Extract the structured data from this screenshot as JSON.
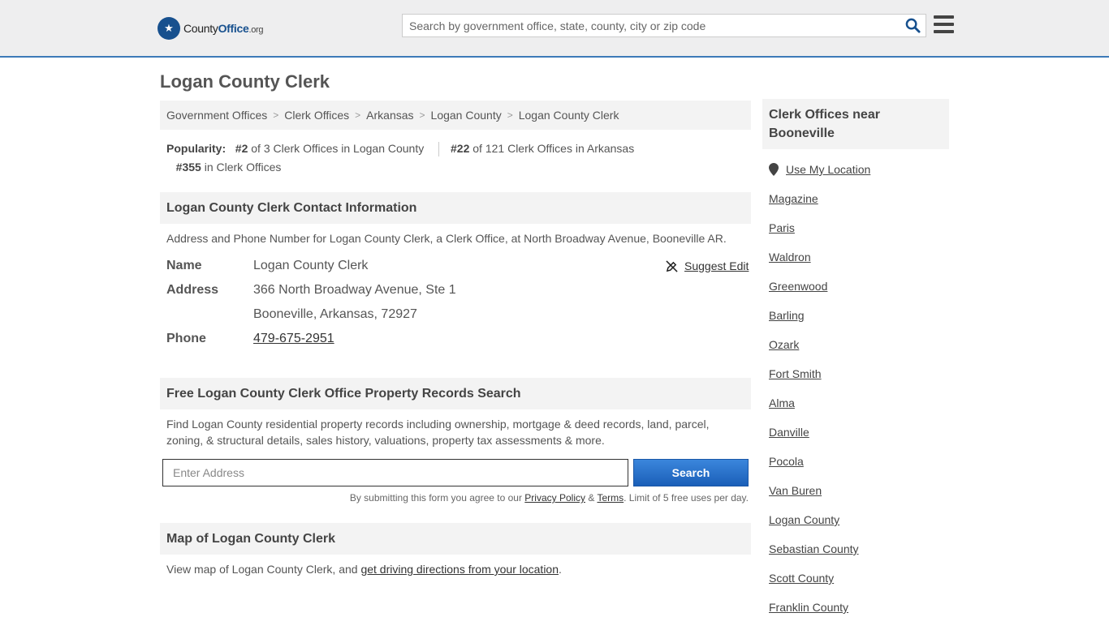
{
  "header": {
    "logo_main": "County",
    "logo_brand": "Office",
    "logo_tld": ".org",
    "search_placeholder": "Search by government office, state, county, city or zip code"
  },
  "page_title": "Logan County Clerk",
  "breadcrumb": [
    "Government Offices",
    "Clerk Offices",
    "Arkansas",
    "Logan County",
    "Logan County Clerk"
  ],
  "popularity": {
    "label": "Popularity:",
    "rank1": "#2",
    "rank1_text": "of 3 Clerk Offices in Logan County",
    "rank2": "#22",
    "rank2_text": "of 121 Clerk Offices in Arkansas",
    "rank3": "#355",
    "rank3_text": "in Clerk Offices"
  },
  "contact": {
    "heading": "Logan County Clerk Contact Information",
    "description": "Address and Phone Number for Logan County Clerk, a Clerk Office, at North Broadway Avenue, Booneville AR.",
    "name_label": "Name",
    "name_value": "Logan County Clerk",
    "address_label": "Address",
    "address_line1": "366 North Broadway Avenue, Ste 1",
    "address_line2": "Booneville, Arkansas, 72927",
    "phone_label": "Phone",
    "phone_value": "479-675-2951",
    "suggest_edit": "Suggest Edit"
  },
  "property": {
    "heading": "Free Logan County Clerk Office Property Records Search",
    "description": "Find Logan County residential property records including ownership, mortgage & deed records, land, parcel, zoning, & structural details, sales history, valuations, property tax assessments & more.",
    "input_placeholder": "Enter Address",
    "button_label": "Search",
    "legal_prefix": "By submitting this form you agree to our",
    "privacy": "Privacy Policy",
    "amp": "&",
    "terms": "Terms",
    "legal_suffix": ". Limit of 5 free uses per day."
  },
  "map": {
    "heading": "Map of Logan County Clerk",
    "description_prefix": "View map of Logan County Clerk, and",
    "link": "get driving directions from your location",
    "description_suffix": "."
  },
  "sidebar": {
    "heading": "Clerk Offices near Booneville",
    "use_location": "Use My Location",
    "items": [
      "Magazine",
      "Paris",
      "Waldron",
      "Greenwood",
      "Barling",
      "Ozark",
      "Fort Smith",
      "Alma",
      "Danville",
      "Pocola",
      "Van Buren",
      "Logan County",
      "Sebastian County",
      "Scott County",
      "Franklin County"
    ]
  },
  "colors": {
    "brand": "#17508e",
    "accent": "#3d7ab8",
    "button": "#1a5fb8"
  }
}
